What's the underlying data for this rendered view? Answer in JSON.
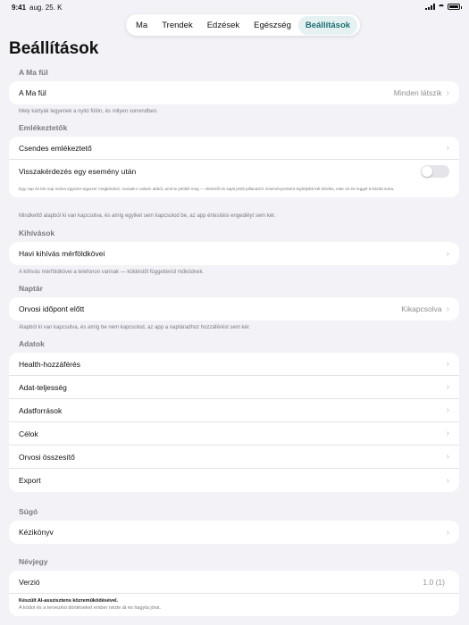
{
  "status": {
    "time": "9:41",
    "date": "aug. 25. K"
  },
  "tabs": [
    {
      "label": "Ma"
    },
    {
      "label": "Trendek"
    },
    {
      "label": "Edzések"
    },
    {
      "label": "Egészség"
    },
    {
      "label": "Beállítások"
    }
  ],
  "page_title": "Beállítások",
  "sections": {
    "ma_ful": {
      "header": "A Ma fül",
      "row_label": "A Ma fül",
      "row_value": "Minden látszik",
      "footnote": "Mely kártyák legyenek a nyitó fülön, és milyen sorrendben."
    },
    "emlekeztetok": {
      "header": "Emlékeztetők",
      "row1_label": "Csendes emlékeztető",
      "row2_label": "Visszakérdezés egy esemény után",
      "toggle_state": "off",
      "inner_note": "Egy nap és két nap múlva egyszer-egyszer megkérdezi, maradt-e valami abból, amit te jelöltél meg — eleséről és saját jelölt pillanatról. Eseményenként legfeljebb két kérdés, este 10 és reggel 8 között soha.",
      "footnote": "Mindkettő alapból ki van kapcsolva, és amíg egyiket sem kapcsolod be, az app értesítési engedélyt sem kér."
    },
    "kihivasok": {
      "header": "Kihívások",
      "row_label": "Havi kihívás mérföldkövei",
      "footnote": "A kihívás mérföldkövei a telefonon vannak — küldéstől függetlenül működnek."
    },
    "naptar": {
      "header": "Naptár",
      "row_label": "Orvosi időpont előtt",
      "row_value": "Kikapcsolva",
      "footnote": "Alapból ki van kapcsolva, és amíg be nem kapcsolod, az app a naptáradhoz hozzáférést sem kér."
    },
    "adatok": {
      "header": "Adatok",
      "rows": [
        "Health-hozzáférés",
        "Adat-teljesség",
        "Adatforrások",
        "Célok",
        "Orvosi összesítő",
        "Export"
      ]
    },
    "sugo": {
      "header": "Súgó",
      "row_label": "Kézikönyv"
    },
    "nevjegy": {
      "header": "Névjegy",
      "row_label": "Verzió",
      "row_value": "1.0 (1)",
      "credit_title": "Készült AI-asszisztens közreműködésével.",
      "credit_text": "A kódot és a tervezési döntéseket ember nézte át és hagyta jóvá."
    }
  },
  "colors": {
    "accent": "#1e6e73",
    "active_tab_bg": "#e6f2f2",
    "background": "#f2f2f7"
  }
}
